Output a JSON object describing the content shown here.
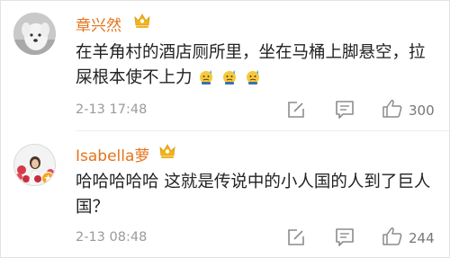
{
  "comments": [
    {
      "username": "章兴然",
      "text": "在羊角村的酒店厕所里，坐在马桶上脚悬空，拉屎根本使不上力",
      "emoji": [
        "sweat-emoji",
        "sweat-emoji",
        "sweat-emoji"
      ],
      "time": "2-13 17:48",
      "likes": "300",
      "avatar": "white-dog-avatar"
    },
    {
      "username": "Isabella萝",
      "text": "哈哈哈哈哈 这就是传说中的小人国的人到了巨人国？",
      "emoji": [],
      "time": "2-13 08:48",
      "likes": "244",
      "avatar": "girl-flowers-avatar"
    }
  ],
  "colors": {
    "username": "#e5731b",
    "text": "#222222",
    "meta": "#9a9a9a",
    "icon": "#8c8c8c",
    "crown": "#f2b41c"
  }
}
